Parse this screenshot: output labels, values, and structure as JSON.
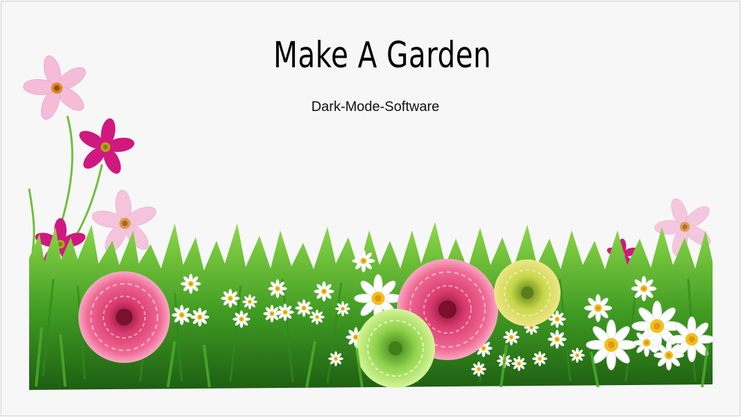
{
  "slide": {
    "title": "Make A Garden",
    "subtitle": "Dark-Mode-Software"
  },
  "image": {
    "description_icon": "flower-garden-image",
    "colors": {
      "grass_dark": "#2f8a1f",
      "grass_light": "#7ccf3a",
      "dahlia_pink": "#e6457a",
      "cosmos_magenta": "#c2187a",
      "cosmos_light": "#f2b3d6",
      "daisy_center": "#f2c018",
      "green_dahlia": "#a7e05a",
      "yellow_dahlia": "#d6df5a"
    }
  }
}
